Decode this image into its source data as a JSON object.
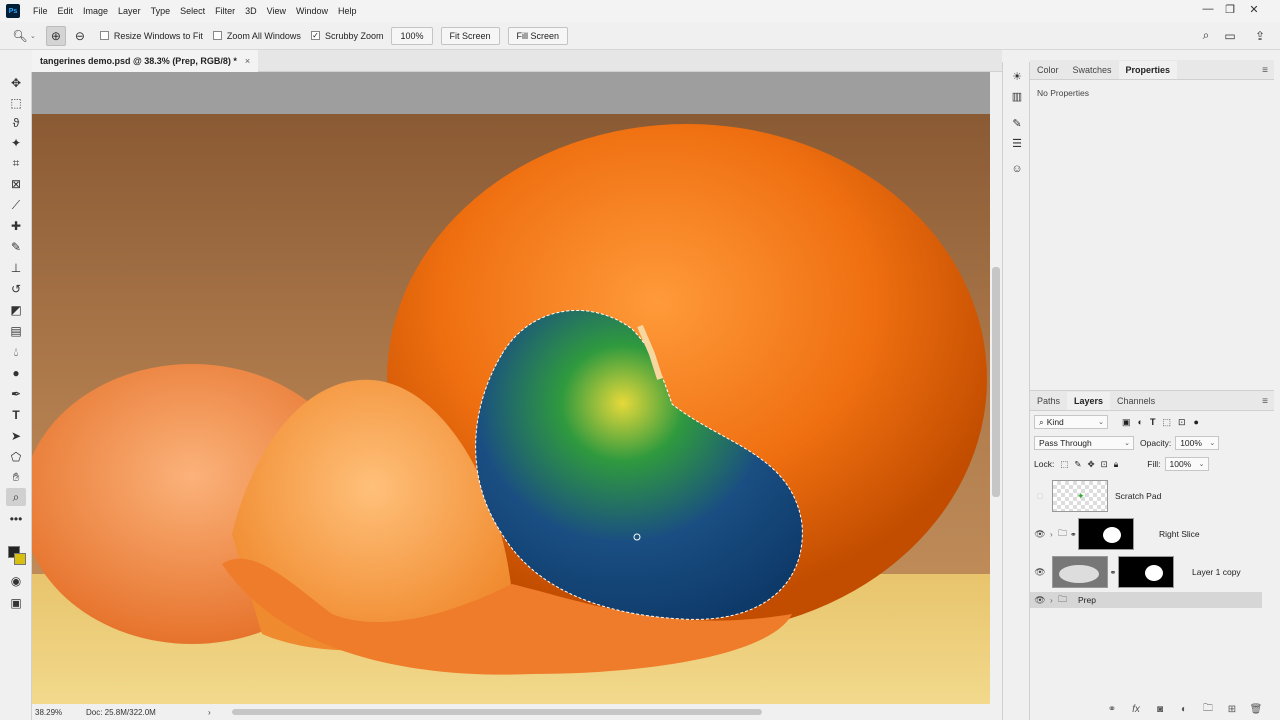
{
  "app": {
    "logo": "Ps"
  },
  "menu": [
    "File",
    "Edit",
    "Image",
    "Layer",
    "Type",
    "Select",
    "Filter",
    "3D",
    "View",
    "Window",
    "Help"
  ],
  "window_controls": {
    "minimize": "—",
    "restore": "❐",
    "close": "✕"
  },
  "options": {
    "resize_windows": "Resize Windows to Fit",
    "zoom_all": "Zoom All Windows",
    "scrubby_zoom": "Scrubby Zoom",
    "scrubby_checked": "✓",
    "zoom_value": "100%",
    "fit_screen": "Fit Screen",
    "fill_screen": "Fill Screen"
  },
  "document": {
    "tab_title": "tangerines demo.psd @ 38.3% (Prep, RGB/8) *",
    "close": "×"
  },
  "status": {
    "zoom": "38.29%",
    "doc": "Doc: 25.8M/322.0M",
    "arrow": "›"
  },
  "properties": {
    "tabs": [
      "Color",
      "Swatches",
      "Properties"
    ],
    "active_tab": "Properties",
    "message": "No Properties",
    "menu": "≡"
  },
  "layers_panel": {
    "tabs": [
      "Paths",
      "Layers",
      "Channels"
    ],
    "active_tab": "Layers",
    "filter_kind": "Kind",
    "blend_mode": "Pass Through",
    "opacity_label": "Opacity:",
    "opacity_value": "100%",
    "lock_label": "Lock:",
    "fill_label": "Fill:",
    "fill_value": "100%",
    "layers": [
      {
        "name": "Scratch Pad"
      },
      {
        "name": "Right Slice"
      },
      {
        "name": "Layer 1 copy"
      },
      {
        "name": "Prep"
      }
    ]
  }
}
